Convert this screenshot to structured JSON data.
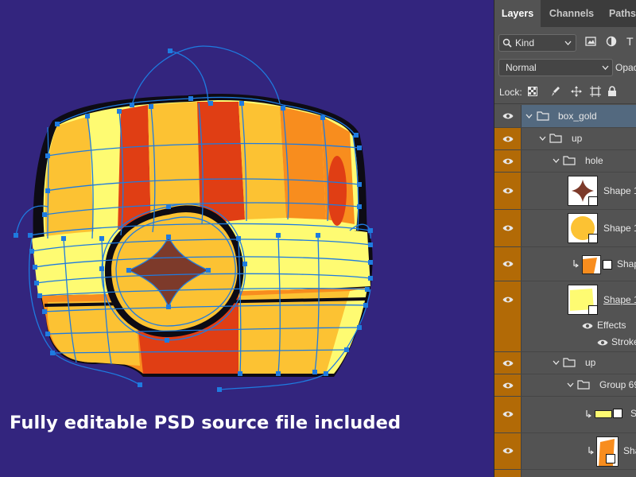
{
  "canvas": {
    "caption": "Fully editable PSD source file included"
  },
  "panel": {
    "tabs": [
      "Layers",
      "Channels",
      "Paths"
    ],
    "filter_kind": "Kind",
    "blend_mode": "Normal",
    "opacity_label": "Opac",
    "lock_label": "Lock:",
    "layers": [
      {
        "name": "box_gold",
        "type": "group"
      },
      {
        "name": "up",
        "type": "group"
      },
      {
        "name": "hole",
        "type": "group"
      },
      {
        "name": "Shape 1",
        "type": "shape"
      },
      {
        "name": "Shape 1",
        "type": "shape"
      },
      {
        "name": "Shap",
        "type": "shape-clipped"
      },
      {
        "name": "Shape 1",
        "type": "shape-underlined"
      },
      {
        "name": "Effects",
        "type": "effects"
      },
      {
        "name": "Stroke",
        "type": "effect"
      },
      {
        "name": "up",
        "type": "group"
      },
      {
        "name": "Group 69",
        "type": "group"
      },
      {
        "name": "S",
        "type": "shape-clipped"
      },
      {
        "name": "Sha",
        "type": "shape-clipped"
      }
    ]
  },
  "colors": {
    "canvas_bg": "#33257e",
    "panel_bg": "#535353",
    "selected_row": "#53697f",
    "eye_column": "#b26a06",
    "path_blue": "#1e7be0",
    "gold": "#fcc233",
    "orange": "#f88d1e",
    "red": "#e03e14",
    "cream": "#fefb72"
  },
  "icons": {
    "visibility": "eye-icon",
    "folder": "folder-icon",
    "search": "search-icon",
    "disclosure": "chevron-down-icon",
    "clip": "clipping-arrow-icon"
  }
}
